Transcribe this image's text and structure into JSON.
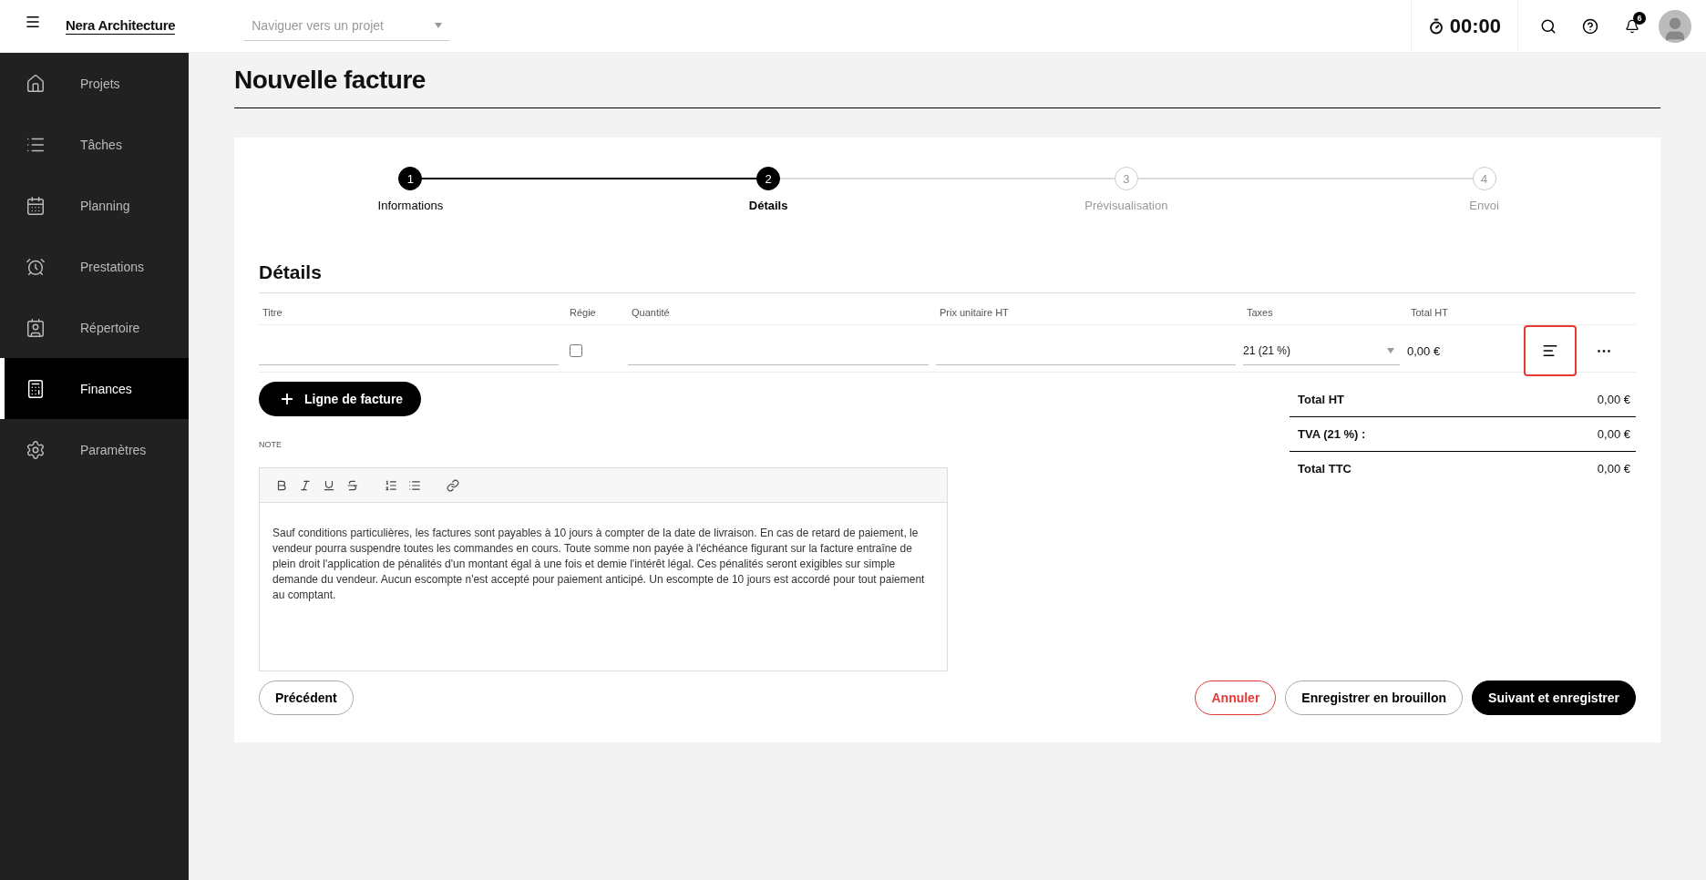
{
  "header": {
    "logo": "Nera Architecture",
    "project_select": {
      "placeholder": "Naviguer vers un projet"
    },
    "timer": "00:00",
    "notification_count": "6"
  },
  "sidebar": {
    "items": [
      {
        "label": "Projets",
        "selected": false
      },
      {
        "label": "Tâches",
        "selected": false
      },
      {
        "label": "Planning",
        "selected": false
      },
      {
        "label": "Prestations",
        "selected": false
      },
      {
        "label": "Répertoire",
        "selected": false
      },
      {
        "label": "Finances",
        "selected": true
      },
      {
        "label": "Paramètres",
        "selected": false
      }
    ]
  },
  "page_title": "Nouvelle facture",
  "stepper": [
    {
      "number": "1",
      "label": "Informations",
      "selected": false
    },
    {
      "number": "2",
      "label": "Détails",
      "selected": true
    },
    {
      "number": "3",
      "label": "Prévisualisation",
      "selected": false
    },
    {
      "number": "4",
      "label": "Envoi",
      "selected": false
    }
  ],
  "section_title": "Détails",
  "table": {
    "columns": [
      "Titre",
      "Régie",
      "Quantité",
      "Prix unitaire HT",
      "Taxes",
      "Total HT"
    ],
    "rows": [
      {
        "regie_checked": false,
        "taxes": "21 (21 %)",
        "total": "0,00 €",
        "note_toggle_highlighted": true
      }
    ]
  },
  "add_line_button": "Ligne de facture",
  "totals": [
    {
      "label": "Total HT",
      "value": "0,00 €"
    },
    {
      "label": "TVA (21 %) :",
      "value": "0,00 €"
    },
    {
      "label": "Total TTC",
      "value": "0,00 €"
    }
  ],
  "note": {
    "label": "NOTE",
    "text": "Sauf conditions particulières, les factures sont payables à 10 jours à compter de la date de livraison. En cas de retard de paiement, le vendeur pourra suspendre toutes les commandes en cours. Toute somme non payée à l'échéance figurant sur la facture entraîne de plein droit l'application de pénalités d'un montant égal à une fois et demie l'intérêt légal. Ces pénalités seront exigibles sur simple demande du vendeur. Aucun escompte n'est accepté pour paiement anticipé. Un escompte de 10 jours est accordé pour tout paiement au comptant."
  },
  "buttons": {
    "previous": "Précédent",
    "cancel": "Annuler",
    "draft": "Enregistrer en brouillon",
    "next": "Suivant et enregistrer"
  }
}
